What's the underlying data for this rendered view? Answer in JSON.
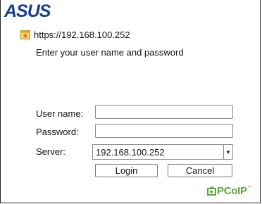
{
  "brand": {
    "logo_alt": "ASUS",
    "color": "#1a3f8f"
  },
  "url_bar": {
    "icon": "web-page-icon",
    "url": "https://192.168.100.252"
  },
  "prompt": "Enter your user name and password",
  "form": {
    "username_label": "User name:",
    "username_value": "",
    "password_label": "Password:",
    "password_value": "",
    "server_label": "Server:",
    "server_value": "192.168.100.252"
  },
  "buttons": {
    "login": "Login",
    "cancel": "Cancel"
  },
  "footer": {
    "pcoip_logo": "PCoIP",
    "pcoip_tm": "™",
    "pcoip_color": "#5aa635"
  }
}
